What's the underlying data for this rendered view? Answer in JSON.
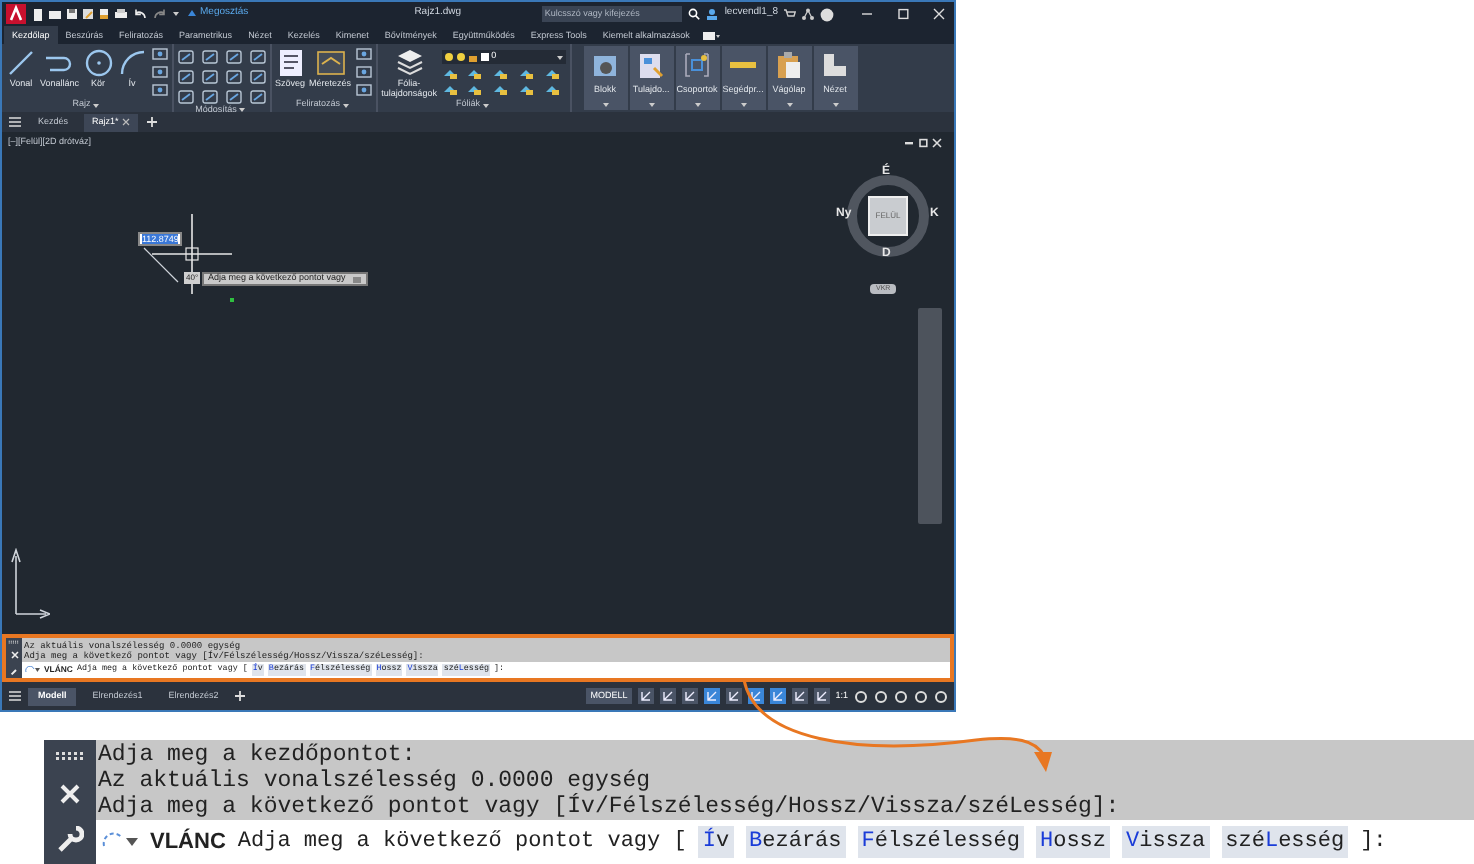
{
  "title_bar": {
    "share": "Megosztás",
    "document": "Rajz1.dwg",
    "search": {
      "placeholder": "Kulcsszó vagy kifejezés"
    },
    "user": "lecvendl1_8"
  },
  "ribbon_tabs": [
    {
      "label": "Kezdőlap",
      "selected": true
    },
    {
      "label": "Beszúrás",
      "selected": false
    },
    {
      "label": "Feliratozás",
      "selected": false
    },
    {
      "label": "Parametrikus",
      "selected": false
    },
    {
      "label": "Nézet",
      "selected": false
    },
    {
      "label": "Kezelés",
      "selected": false
    },
    {
      "label": "Kimenet",
      "selected": false
    },
    {
      "label": "Bővítmények",
      "selected": false
    },
    {
      "label": "Együttműködés",
      "selected": false
    },
    {
      "label": "Express Tools",
      "selected": false
    },
    {
      "label": "Kiemelt alkalmazások",
      "selected": false
    }
  ],
  "ribbon_panels": [
    {
      "title": "Rajz",
      "tools": [
        {
          "label": "Vonal",
          "kind": "line"
        },
        {
          "label": "Vonallánc",
          "kind": "polyline"
        },
        {
          "label": "Kör",
          "kind": "circle"
        },
        {
          "label": "Ív",
          "kind": "arc"
        }
      ]
    },
    {
      "title": "Módosítás"
    },
    {
      "title": "Feliratozás",
      "tools": [
        {
          "label": "Szöveg",
          "kind": "text"
        },
        {
          "label": "Méretezés",
          "kind": "dimension"
        }
      ]
    },
    {
      "title": "Fóliák",
      "tools": [
        {
          "label": "Fólia-tulajdonságok",
          "kind": "layers"
        }
      ],
      "layer": "0"
    }
  ],
  "ribbon_buttons": [
    {
      "label": "Blokk",
      "kind": "block"
    },
    {
      "label": "Tulajdo...",
      "kind": "properties"
    },
    {
      "label": "Csoportok",
      "kind": "group"
    },
    {
      "label": "Segédpr...",
      "kind": "utilities"
    },
    {
      "label": "Vágólap",
      "kind": "clipboard"
    },
    {
      "label": "Nézet",
      "kind": "view"
    }
  ],
  "file_tabs": [
    {
      "label": "Kezdés",
      "selected": false
    },
    {
      "label": "Rajz1*",
      "selected": true
    }
  ],
  "viewport": {
    "label": "[–][Felül][2D drótváz]",
    "compass": {
      "north": "É",
      "west": "Ny",
      "east": "K",
      "south": "D",
      "top": "FELÜL"
    },
    "ucs": "VKR"
  },
  "dynamic_input": {
    "value": "112.8749",
    "angle": "40°",
    "tooltip": "Adja meg a következő pontot vagy"
  },
  "command_line": {
    "history": [
      "Az aktuális vonalszélesség 0.0000 egység",
      "Adja meg a következő pontot vagy [Ív/Félszélesség/Hossz/Vissza/széLesség]:"
    ],
    "command": "VLÁNC",
    "prompt": "Adja meg a következő pontot vagy [",
    "options": [
      {
        "key": "Í",
        "after": "v"
      },
      {
        "key": "B",
        "after": "ezárás"
      },
      {
        "key": "F",
        "after": "élszélesség"
      },
      {
        "key": "H",
        "after": "ossz"
      },
      {
        "key": "V",
        "after": "issza"
      },
      {
        "before": "szé",
        "key": "L",
        "after": "esség"
      }
    ],
    "end": "]:"
  },
  "layout_tabs": [
    {
      "label": "Modell",
      "selected": true
    },
    {
      "label": "Elrendezés1",
      "selected": false
    },
    {
      "label": "Elrendezés2",
      "selected": false
    }
  ],
  "status_bar": {
    "space": "MODELL",
    "scale": "1:1"
  },
  "callout": {
    "history": [
      "Adja meg a kezdőpontot:",
      "Az aktuális vonalszélesség 0.0000 egység",
      "Adja meg a következő pontot vagy [Ív/Félszélesség/Hossz/Vissza/széLesség]:"
    ],
    "command": "VLÁNC",
    "prompt": "Adja meg a következő pontot vagy [",
    "options": [
      {
        "key": "Í",
        "after": "v"
      },
      {
        "key": "B",
        "after": "ezárás"
      },
      {
        "key": "F",
        "after": "élszélesség"
      },
      {
        "key": "H",
        "after": "ossz"
      },
      {
        "key": "V",
        "after": "issza"
      },
      {
        "before": "szé",
        "key": "L",
        "after": "esség"
      }
    ],
    "end": "]:"
  }
}
